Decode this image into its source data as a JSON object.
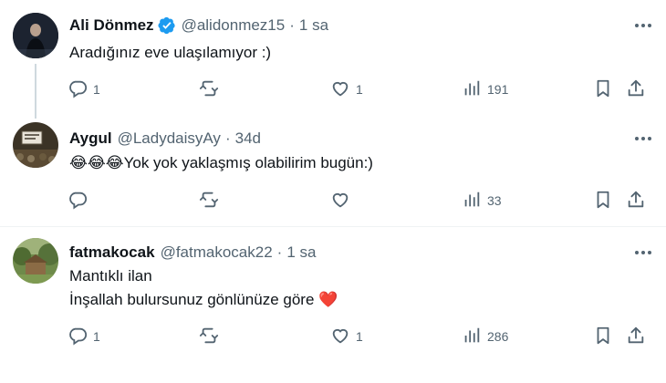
{
  "tweets": [
    {
      "name": "Ali Dönmez",
      "verified": true,
      "handle": "@alidonmez15",
      "separator": "·",
      "time": "1 sa",
      "text": "Aradığınız eve ulaşılamıyor :)",
      "replies": "1",
      "retweets": "",
      "likes": "1",
      "views": "191"
    },
    {
      "name": "Aygul",
      "verified": false,
      "handle": "@LadydaisyAy",
      "separator": "·",
      "time": "34d",
      "emoji_prefix": "😂😂😂",
      "text": "Yok yok yaklaşmış olabilirim bugün:)",
      "replies": "",
      "retweets": "",
      "likes": "",
      "views": "33"
    },
    {
      "name": "fatmakocak",
      "verified": false,
      "handle": "@fatmakocak22",
      "separator": "·",
      "time": "1 sa",
      "text_line1": "Mantıklı ilan",
      "text_line2": "İnşallah bulursunuz gönlünüze göre",
      "text_emoji": "❤️",
      "replies": "1",
      "retweets": "",
      "likes": "1",
      "views": "286"
    }
  ],
  "colors": {
    "text": "#0f1419",
    "secondary": "#536471",
    "verified": "#1d9bf0",
    "heart": "#e0245e",
    "divider": "#eff3f4"
  },
  "icons": [
    "reply-icon",
    "retweet-icon",
    "like-icon",
    "views-icon",
    "bookmark-icon",
    "share-icon",
    "more-icon",
    "verified-icon"
  ]
}
